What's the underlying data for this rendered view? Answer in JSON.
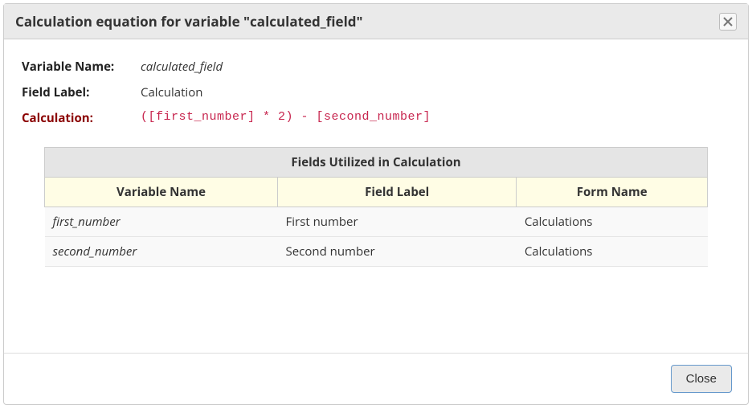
{
  "dialog": {
    "title": "Calculation equation for variable \"calculated_field\""
  },
  "info": {
    "varname_label": "Variable Name:",
    "varname_value": "calculated_field",
    "fieldlabel_label": "Field Label:",
    "fieldlabel_value": "Calculation",
    "calc_label": "Calculation:",
    "calc_value": "([first_number] * 2) - [second_number]"
  },
  "fields": {
    "caption": "Fields Utilized in Calculation",
    "headers": {
      "var": "Variable Name",
      "label": "Field Label",
      "form": "Form Name"
    },
    "rows": [
      {
        "var": "first_number",
        "label": "First number",
        "form": "Calculations"
      },
      {
        "var": "second_number",
        "label": "Second number",
        "form": "Calculations"
      }
    ]
  },
  "footer": {
    "close_label": "Close"
  }
}
